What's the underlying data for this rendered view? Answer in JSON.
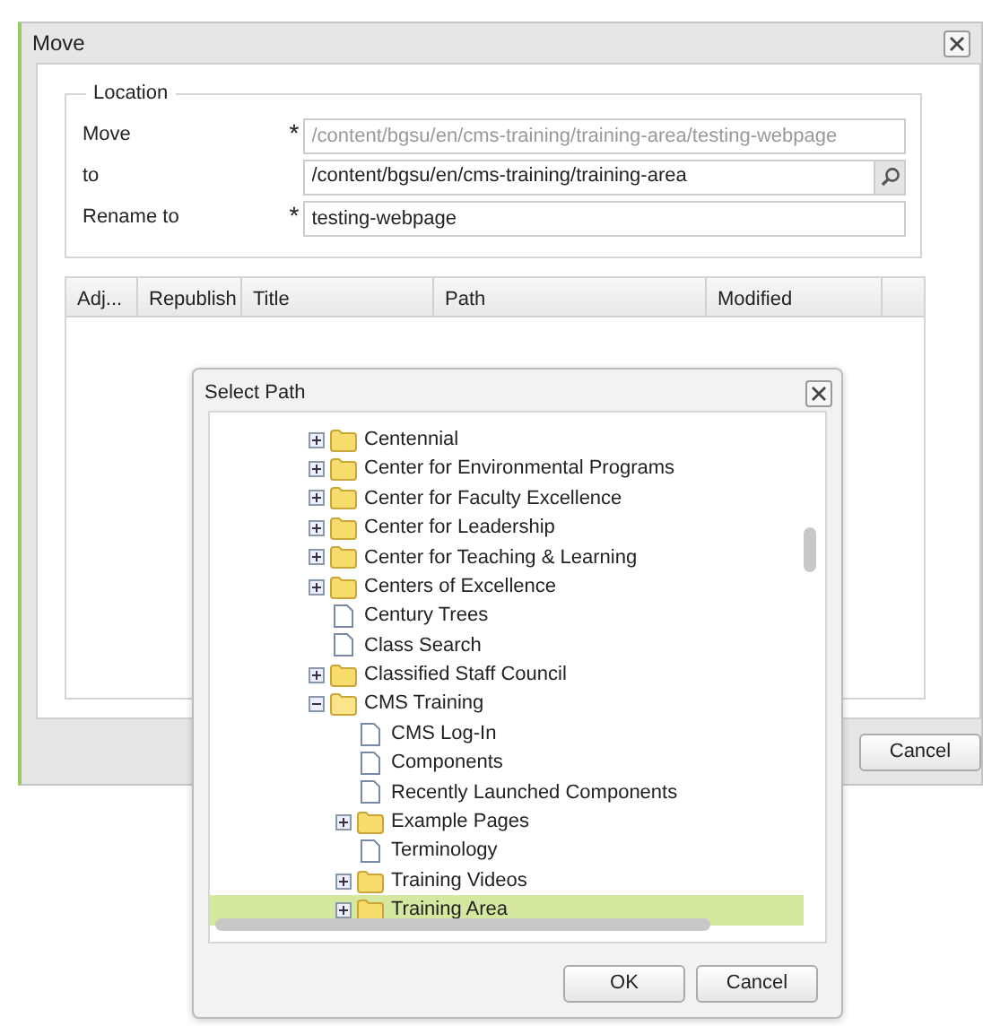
{
  "move_dialog": {
    "title": "Move",
    "location": {
      "legend": "Location",
      "fields": [
        {
          "label": "Move",
          "marker": "*",
          "disabled": true,
          "kind": "text",
          "value": "/content/bgsu/en/cms-training/training-area/testing-webpage"
        },
        {
          "label": "to",
          "disabled": false,
          "kind": "path",
          "value": "/content/bgsu/en/cms-training/training-area"
        },
        {
          "label": "Rename to",
          "marker": "*",
          "disabled": false,
          "kind": "text",
          "value": "testing-webpage"
        }
      ]
    },
    "table": {
      "columns": [
        "Adj...",
        "Republish",
        "Title",
        "Path",
        "Modified"
      ]
    },
    "buttons": [
      "Cancel"
    ]
  },
  "select_path_dialog": {
    "title": "Select Path",
    "tree": [
      {
        "label": "Centennial",
        "kind": "folder",
        "expanded": false,
        "selected": false
      },
      {
        "label": "Center for Environmental Programs",
        "kind": "folder",
        "expanded": false,
        "selected": false
      },
      {
        "label": "Center for Faculty Excellence",
        "kind": "folder",
        "expanded": false,
        "selected": false
      },
      {
        "label": "Center for Leadership",
        "kind": "folder",
        "expanded": false,
        "selected": false
      },
      {
        "label": "Center for Teaching & Learning",
        "kind": "folder",
        "expanded": false,
        "selected": false
      },
      {
        "label": "Centers of Excellence",
        "kind": "folder",
        "expanded": false,
        "selected": false
      },
      {
        "label": "Century Trees",
        "kind": "page",
        "selected": false
      },
      {
        "label": "Class Search",
        "kind": "page",
        "selected": false
      },
      {
        "label": "Classified Staff Council",
        "kind": "folder",
        "expanded": false,
        "selected": false
      },
      {
        "label": "CMS Training",
        "kind": "folder",
        "expanded": true,
        "selected": false,
        "children": [
          {
            "label": "CMS Log-In",
            "kind": "page",
            "selected": false
          },
          {
            "label": "Components",
            "kind": "page",
            "selected": false
          },
          {
            "label": "Recently Launched Components",
            "kind": "page",
            "selected": false
          },
          {
            "label": "Example Pages",
            "kind": "folder",
            "expanded": false,
            "selected": false
          },
          {
            "label": "Terminology",
            "kind": "page",
            "selected": false
          },
          {
            "label": "Training Videos",
            "kind": "folder",
            "expanded": false,
            "selected": false
          },
          {
            "label": "Training Area",
            "kind": "folder",
            "expanded": false,
            "selected": true
          }
        ]
      }
    ],
    "buttons": [
      "OK",
      "Cancel"
    ]
  }
}
